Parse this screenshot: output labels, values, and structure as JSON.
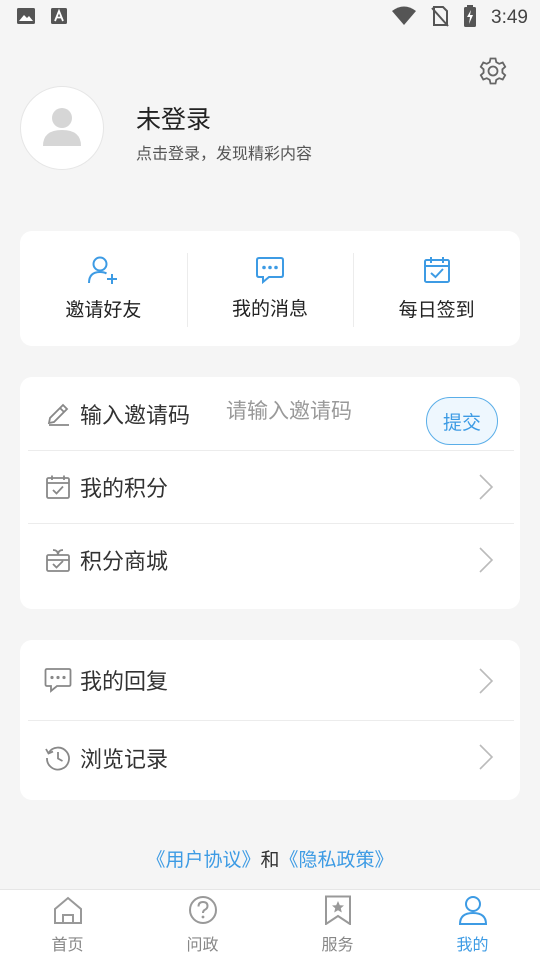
{
  "status_bar": {
    "time": "3:49"
  },
  "profile": {
    "name": "未登录",
    "subtitle": "点击登录，发现精彩内容"
  },
  "quick_actions": [
    {
      "label": "邀请好友",
      "icon": "add-user-icon"
    },
    {
      "label": "我的消息",
      "icon": "message-icon"
    },
    {
      "label": "每日签到",
      "icon": "calendar-check-icon"
    }
  ],
  "invite": {
    "label": "输入邀请码",
    "placeholder": "请输入邀请码",
    "submit_label": "提交"
  },
  "menu_points": [
    {
      "label": "我的积分",
      "icon": "calendar-check-icon"
    },
    {
      "label": "积分商城",
      "icon": "gift-icon"
    }
  ],
  "menu_activity": [
    {
      "label": "我的回复",
      "icon": "comment-icon"
    },
    {
      "label": "浏览记录",
      "icon": "history-icon"
    }
  ],
  "agreement": {
    "user_agreement": "《用户协议》",
    "and": "和",
    "privacy_policy": "《隐私政策》"
  },
  "tabbar": [
    {
      "label": "首页",
      "icon": "home-icon",
      "active": false
    },
    {
      "label": "问政",
      "icon": "question-icon",
      "active": false
    },
    {
      "label": "服务",
      "icon": "bookmark-star-icon",
      "active": false
    },
    {
      "label": "我的",
      "icon": "user-icon",
      "active": true
    }
  ],
  "colors": {
    "accent": "#3d9be4",
    "background": "#f5f5f5"
  }
}
